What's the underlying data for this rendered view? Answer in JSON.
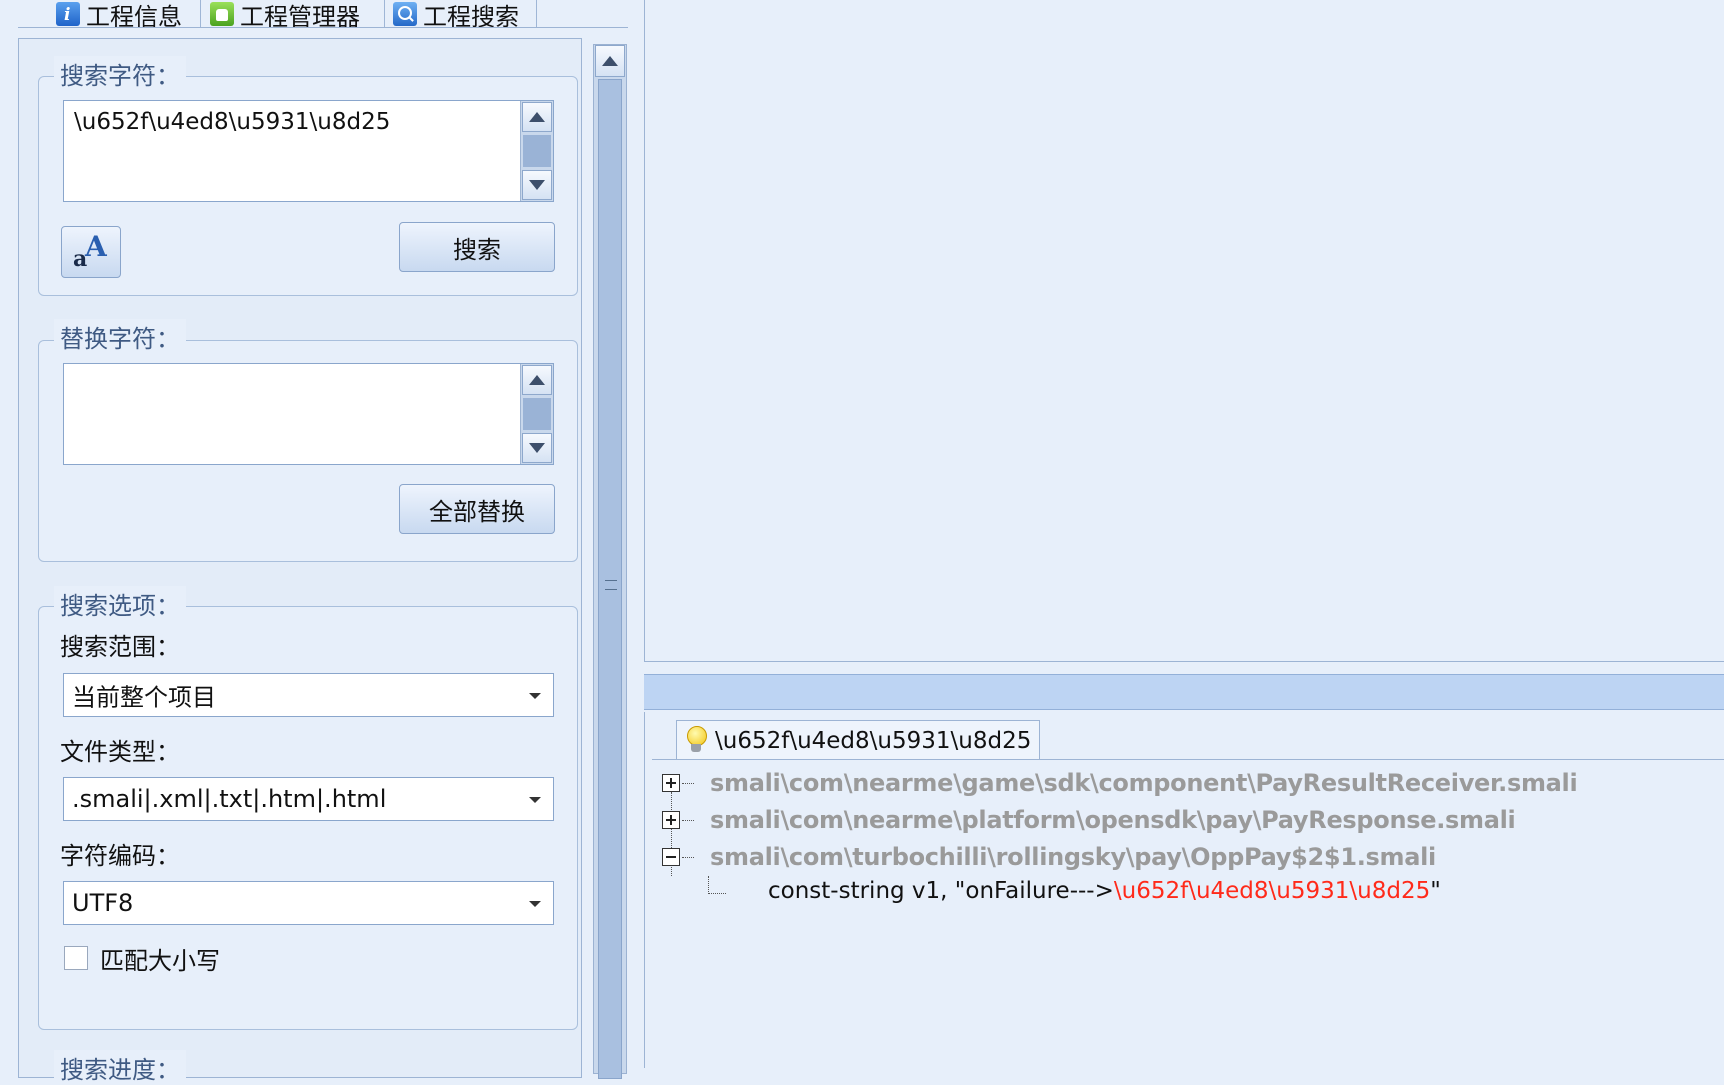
{
  "tabs": [
    {
      "label": "工程信息",
      "icon": "info-icon"
    },
    {
      "label": "工程管理器",
      "icon": "android-icon"
    },
    {
      "label": "工程搜索",
      "icon": "search-icon"
    }
  ],
  "search_group": {
    "legend": "搜索字符：",
    "query_value": "\\u652f\\u4ed8\\u5931\\u8d25",
    "search_button": "搜索",
    "font_icon": "font-size-icon"
  },
  "replace_group": {
    "legend": "替换字符：",
    "replace_value": "",
    "replace_all_button": "全部替换"
  },
  "options_group": {
    "legend": "搜索选项：",
    "scope_label": "搜索范围：",
    "scope_value": "当前整个项目",
    "filetype_label": "文件类型：",
    "filetype_value": ".smali|.xml|.txt|.htm|.html",
    "encoding_label": "字符编码：",
    "encoding_value": "UTF8",
    "match_case_label": "匹配大小写",
    "match_case_checked": false
  },
  "progress_group": {
    "legend": "搜索进度："
  },
  "results": {
    "tab_label": "\\u652f\\u4ed8\\u5931\\u8d25",
    "tab_icon": "lightbulb-icon",
    "files": [
      {
        "path": "smali\\com\\nearme\\game\\sdk\\component\\PayResultReceiver.smali",
        "expanded": false
      },
      {
        "path": "smali\\com\\nearme\\platform\\opensdk\\pay\\PayResponse.smali",
        "expanded": false
      },
      {
        "path": "smali\\com\\turbochilli\\rollingsky\\pay\\OppPay$2$1.smali",
        "expanded": true
      }
    ],
    "match_line": {
      "prefix": "const-string v1, \"onFailure--->",
      "highlight": "\\u652f\\u4ed8\\u5931\\u8d25",
      "suffix": "\""
    }
  },
  "colors": {
    "highlight": "#ff2a1a",
    "path_text": "#9a9a9a",
    "legend_text": "#3f5a83"
  }
}
